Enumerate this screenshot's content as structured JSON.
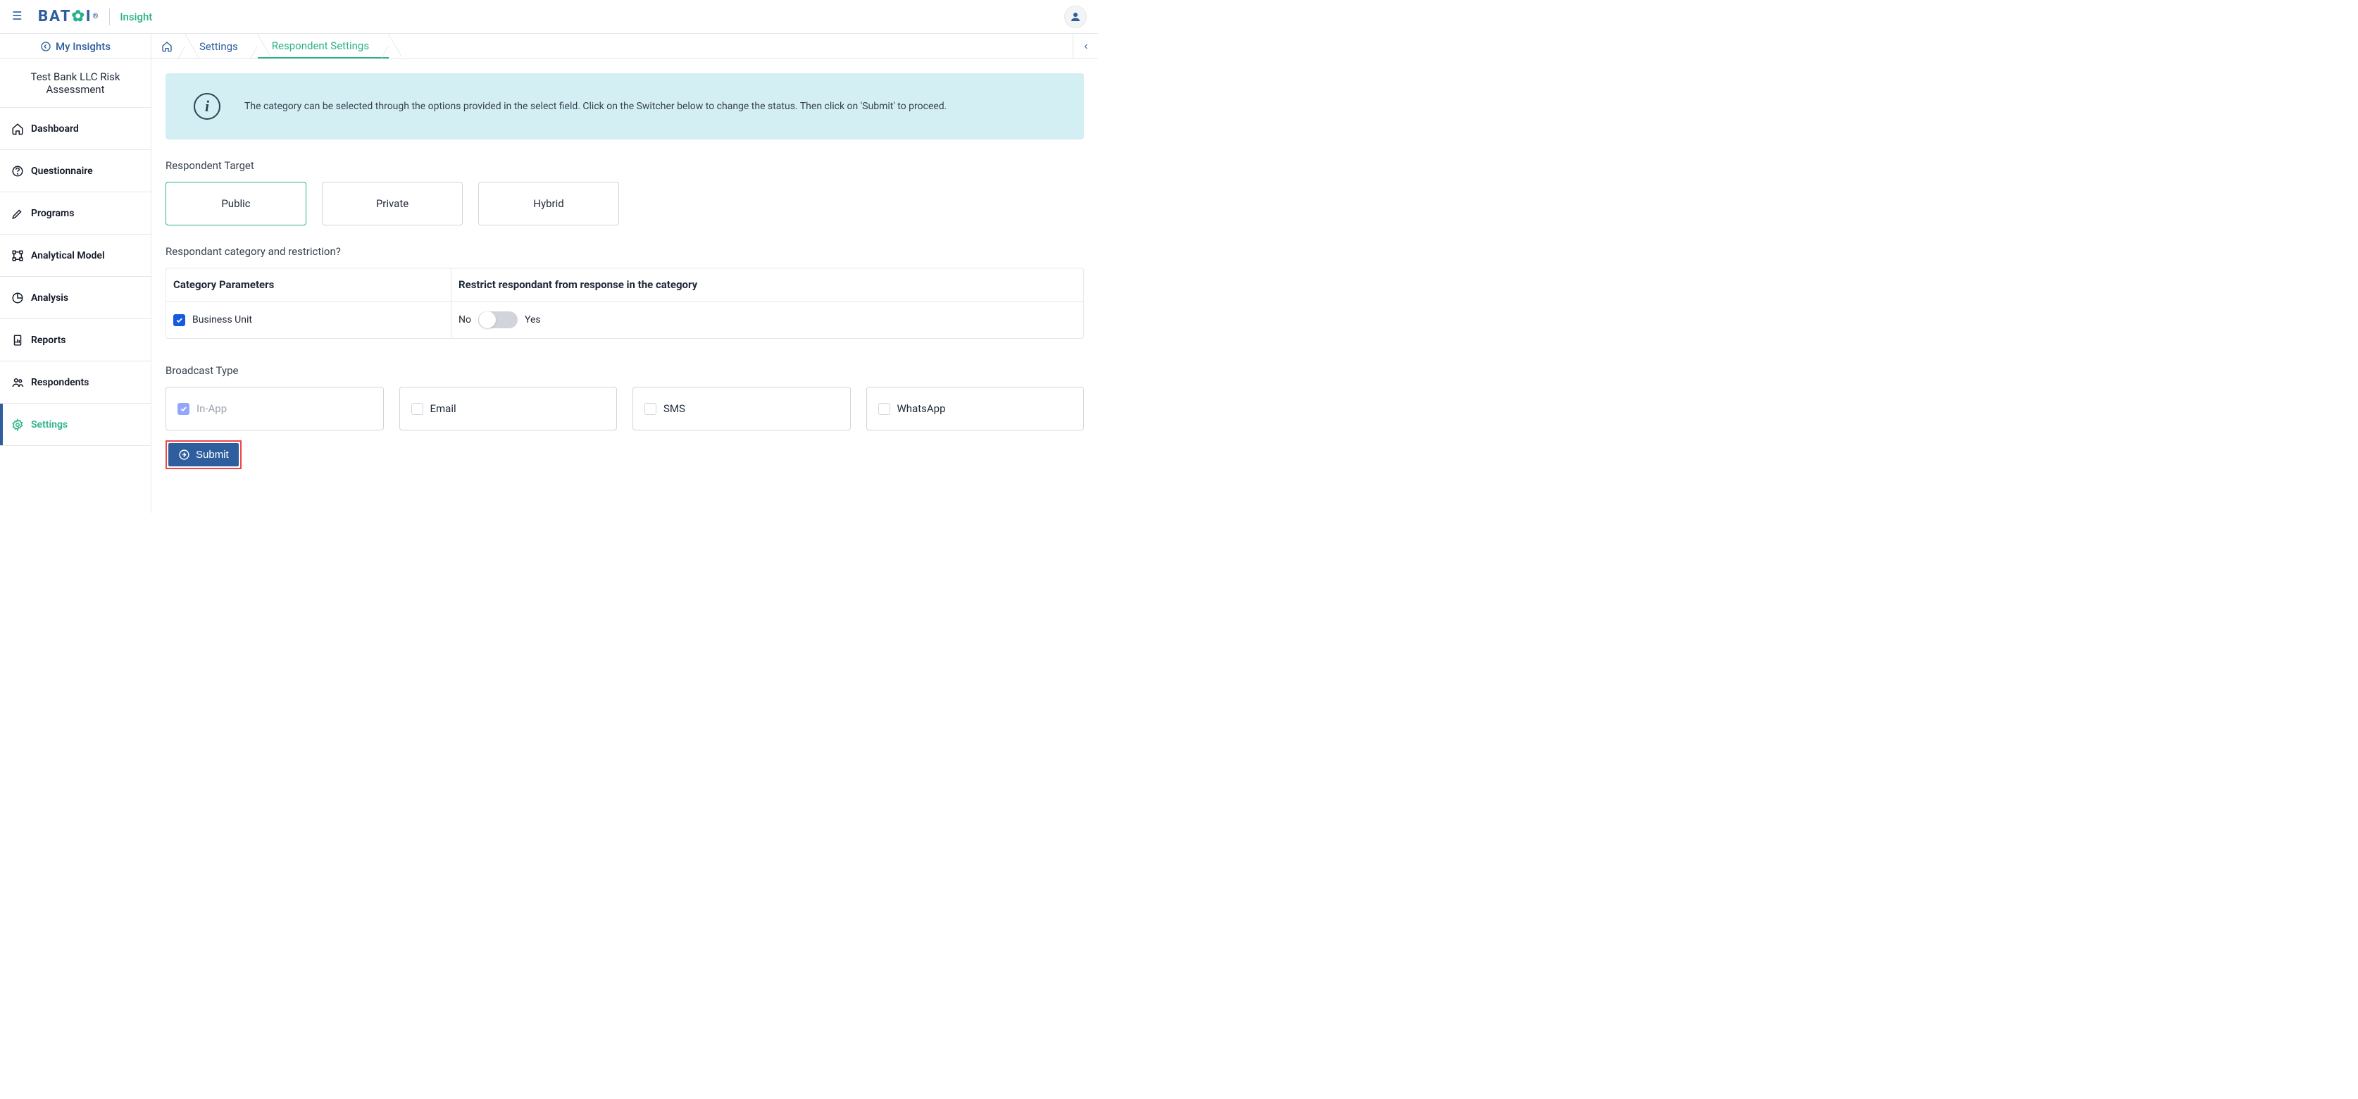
{
  "brand": {
    "insight": "Insight"
  },
  "sidebar": {
    "myInsights": "My Insights",
    "projectTitle": "Test Bank LLC Risk Assessment",
    "items": [
      {
        "label": "Dashboard"
      },
      {
        "label": "Questionnaire"
      },
      {
        "label": "Programs"
      },
      {
        "label": "Analytical Model"
      },
      {
        "label": "Analysis"
      },
      {
        "label": "Reports"
      },
      {
        "label": "Respondents"
      },
      {
        "label": "Settings"
      }
    ]
  },
  "breadcrumb": {
    "settings": "Settings",
    "respondentSettings": "Respondent Settings"
  },
  "banner": {
    "text": "The category can be selected through the options provided in the select field. Click on the Switcher below to change the status. Then click on 'Submit' to proceed."
  },
  "respondentTarget": {
    "label": "Respondent Target",
    "options": [
      "Public",
      "Private",
      "Hybrid"
    ],
    "selected": "Public"
  },
  "categoryTable": {
    "label": "Respondant category and restriction?",
    "headers": {
      "a": "Category Parameters",
      "b": "Restrict respondant from response in the category"
    },
    "row": {
      "label": "Business Unit",
      "noLabel": "No",
      "yesLabel": "Yes"
    }
  },
  "broadcast": {
    "label": "Broadcast Type",
    "options": [
      "In-App",
      "Email",
      "SMS",
      "WhatsApp"
    ]
  },
  "submit": {
    "label": "Submit"
  }
}
